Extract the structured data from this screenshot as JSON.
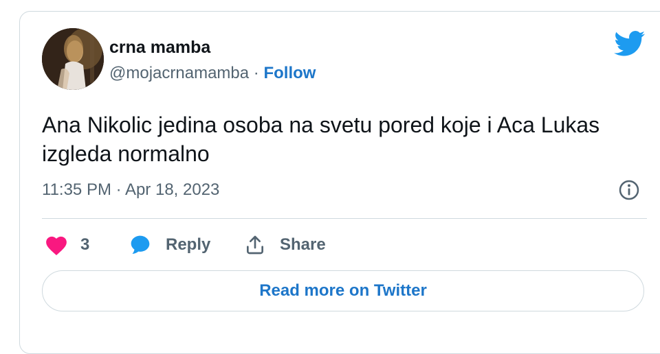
{
  "author": {
    "display_name": "crna mamba",
    "handle": "@mojacrnamamba",
    "separator": "·",
    "follow_label": "Follow"
  },
  "tweet": {
    "text": "Ana Nikolic jedina osoba na svetu pored koje i Aca Lukas izgleda normalno",
    "timestamp": "11:35 PM · Apr 18, 2023"
  },
  "actions": {
    "like_count": "3",
    "reply_label": "Reply",
    "share_label": "Share"
  },
  "read_more_label": "Read more on Twitter",
  "colors": {
    "brand_blue": "#1d9bf0",
    "link_blue": "#1d76c9",
    "like_pink": "#f91880",
    "text_primary": "#0f1419",
    "text_secondary": "#536471",
    "border": "#cfd9de"
  },
  "icons": {
    "brand": "twitter-bird-icon",
    "info": "info-icon",
    "like": "heart-icon",
    "reply": "speech-bubble-icon",
    "share": "share-upload-icon"
  }
}
